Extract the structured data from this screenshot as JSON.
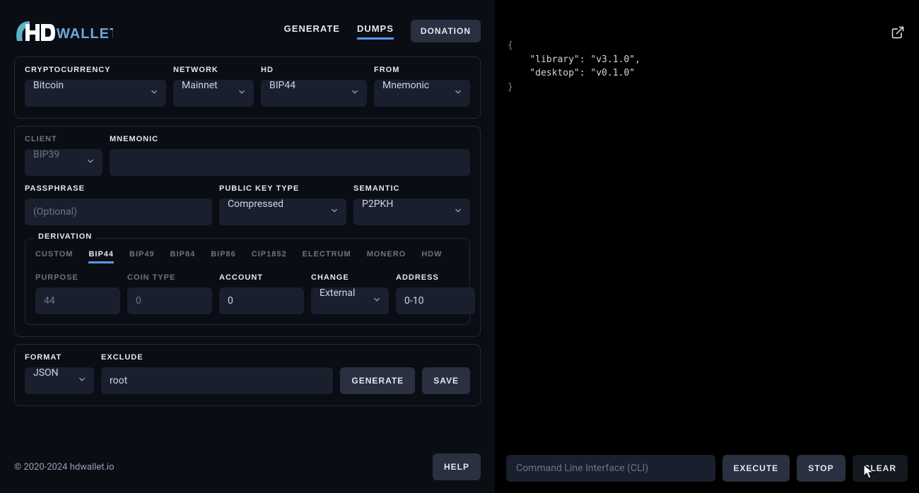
{
  "logo_text": "WALLET",
  "nav": {
    "generate": "GENERATE",
    "dumps": "DUMPS",
    "donation": "DONATION"
  },
  "top": {
    "crypto_label": "CRYPTOCURRENCY",
    "crypto_value": "Bitcoin",
    "network_label": "NETWORK",
    "network_value": "Mainnet",
    "hd_label": "HD",
    "hd_value": "BIP44",
    "from_label": "FROM",
    "from_value": "Mnemonic"
  },
  "mid": {
    "client_label": "CLIENT",
    "client_value": "BIP39",
    "mnemonic_label": "MNEMONIC",
    "mnemonic_value": "",
    "passphrase_label": "PASSPHRASE",
    "passphrase_placeholder": "(Optional)",
    "pkt_label": "PUBLIC KEY TYPE",
    "pkt_value": "Compressed",
    "semantic_label": "SEMANTIC",
    "semantic_value": "P2PKH"
  },
  "derivation": {
    "title": "DERIVATION",
    "tabs": {
      "custom": "CUSTOM",
      "bip44": "BIP44",
      "bip49": "BIP49",
      "bip84": "BIP84",
      "bip86": "BIP86",
      "cip1852": "CIP1852",
      "electrum": "ELECTRUM",
      "monero": "MONERO",
      "hdw": "HDW"
    },
    "purpose_label": "PURPOSE",
    "purpose_value": "44",
    "cointype_label": "COIN TYPE",
    "cointype_value": "0",
    "account_label": "ACCOUNT",
    "account_value": "0",
    "change_label": "CHANGE",
    "change_value": "External",
    "address_label": "ADDRESS",
    "address_value": "0-10"
  },
  "bottom": {
    "format_label": "FORMAT",
    "format_value": "JSON",
    "exclude_label": "EXCLUDE",
    "exclude_value": "root",
    "generate_btn": "GENERATE",
    "save_btn": "SAVE"
  },
  "footer": {
    "copyright": "© 2020-2024 hdwallet.io",
    "help_btn": "HELP"
  },
  "output": {
    "line1": "{",
    "line2": "    \"library\": \"v3.1.0\",",
    "line3": "    \"desktop\": \"v0.1.0\"",
    "line4": "}"
  },
  "cli": {
    "placeholder": "Command Line Interface (CLI)",
    "execute": "EXECUTE",
    "stop": "STOP",
    "clear": "CLEAR"
  }
}
